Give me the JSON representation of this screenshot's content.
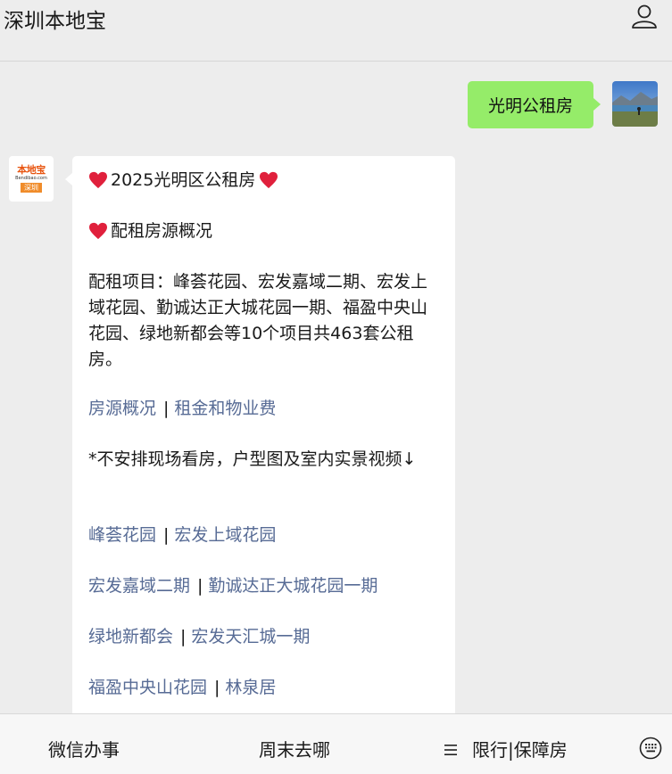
{
  "header": {
    "title": "深圳本地宝",
    "profile_icon": "person-icon"
  },
  "user_message": {
    "text": "光明公租房",
    "bubble_color": "#95ec69"
  },
  "bot_avatar": {
    "line1": "本地宝",
    "line2": "Bendibao.com",
    "line3": "深圳"
  },
  "bot_message": {
    "title": "2025光明区公租房",
    "section": "配租房源概况",
    "intro": "配租项目：峰荟花园、宏发嘉域二期、宏发上域花园、勤诚达正大城花园一期、福盈中央山花园、绿地新都会等10个项目共463套公租房。",
    "links_row1": {
      "a": "房源概况",
      "sep": "|",
      "b": "租金和物业费"
    },
    "note": "*不安排现场看房，户型图及室内实景视频↓",
    "project_rows": [
      {
        "a": "峰荟花园",
        "sep": "|",
        "b": "宏发上域花园"
      },
      {
        "a": "宏发嘉域二期",
        "sep": "|",
        "b": "勤诚达正大城花园一期"
      },
      {
        "a": "绿地新都会",
        "sep": "|",
        "b": "宏发天汇城一期"
      },
      {
        "a": "福盈中央山花园",
        "sep": "|",
        "b": "林泉居"
      }
    ],
    "link_color": "#576b95",
    "heart_icon": "heart-icon"
  },
  "footer": {
    "menu1": "微信办事",
    "menu2": "周末去哪",
    "menu3_icon": "hamburger-icon",
    "menu3": "限行|保障房",
    "keyboard_icon": "keyboard-icon"
  }
}
